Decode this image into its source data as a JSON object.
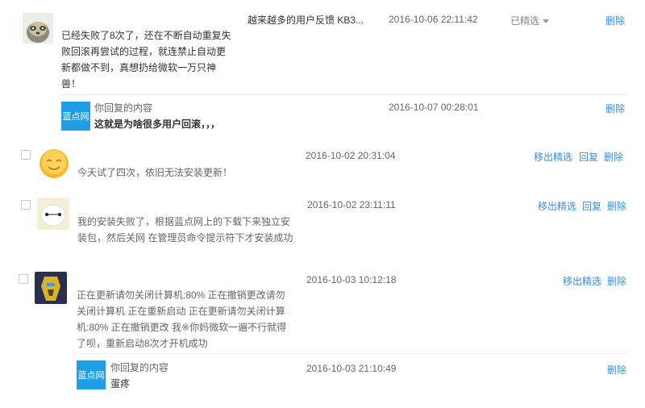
{
  "comments": [
    {
      "title": "越来越多的用户反馈 KB3...",
      "time": "2016-10-06 22:11:42",
      "status": "已精选",
      "text": "已经失败了8次了，还在不断自动重复失败回滚再尝试的过程，就连禁止自动更新都做不到，真想扔给微软一万只神兽！",
      "actions": [
        "删除"
      ],
      "reply": {
        "logo": "蓝点网",
        "label": "你回复的内容",
        "text": "这就是为啥很多用户回滚，，，",
        "time": "2016-10-07 00:28:01",
        "action": "删除"
      }
    },
    {
      "time": "2016-10-02 20:31:04",
      "text": "今天试了四次，依旧无法安装更新！",
      "actions": [
        "移出精选",
        "回复",
        "删除"
      ]
    },
    {
      "time": "2016-10-02 23:11:11",
      "text": "我的安装失败了，根据蓝点网上的下载下来独立安装包，然后关网 在管理员命令提示符下才安装成功",
      "actions": [
        "移出精选",
        "回复",
        "删除"
      ]
    },
    {
      "time": "2016-10-03 10:12:18",
      "text": "正在更新请勿关闭计算机:80% 正在撤销更改请勿关闭计算机 正在重新启动 正在更新请勿关闭计算机:80% 正在撤销更改 我※你妈微软一遍不行就得了呗，重新启动8次才开机成功",
      "actions": [
        "移出精选",
        "删除"
      ],
      "reply": {
        "logo": "蓝点网",
        "label": "你回复的内容",
        "text": "蛋疼",
        "time": "2016-10-03 21:10:49",
        "action": "删除"
      }
    }
  ],
  "colors": {
    "link": "#3b8fd9",
    "logo_bg": "#1f9ee6"
  },
  "icons": {
    "avatar0": "sloth-avatar",
    "avatar1": "smiley-avatar",
    "avatar2": "robot-avatar",
    "avatar3": "transformer-avatar"
  }
}
